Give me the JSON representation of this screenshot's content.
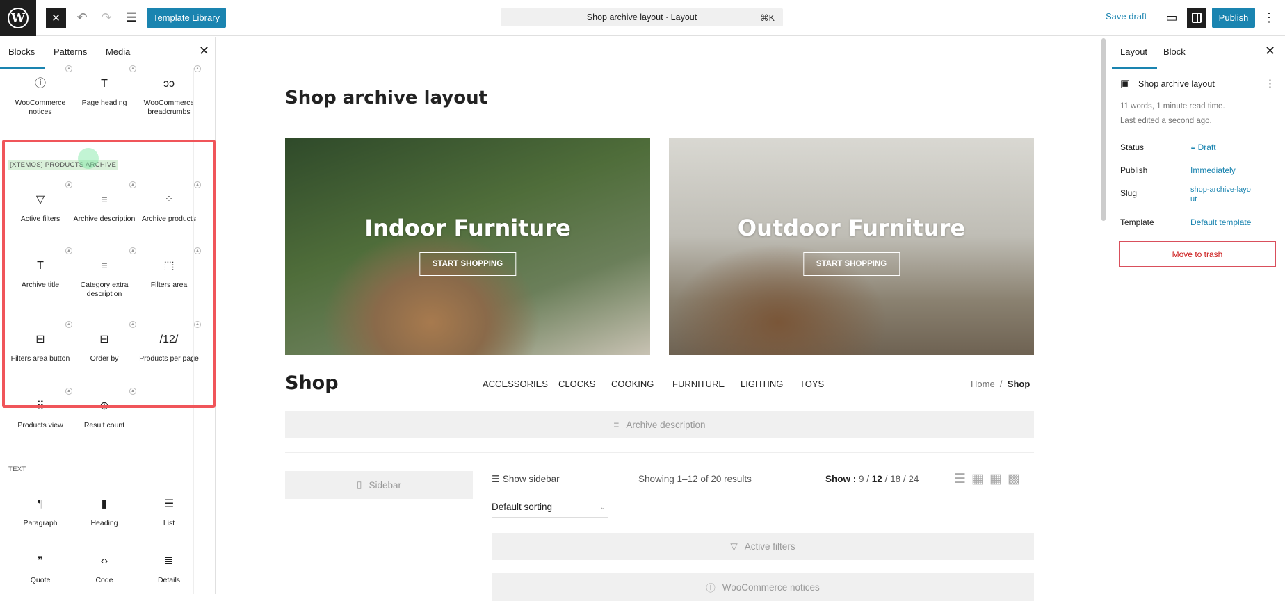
{
  "topbar": {
    "template_library": "Template Library",
    "command": "Shop archive layout · Layout",
    "shortcut": "⌘K",
    "save_draft": "Save draft",
    "publish": "Publish"
  },
  "inserter": {
    "tabs": [
      "Blocks",
      "Patterns",
      "Media"
    ],
    "top_blocks": [
      {
        "label": "WooCommerce notices",
        "icon": "info-icon"
      },
      {
        "label": "Page heading",
        "icon": "heading-icon"
      },
      {
        "label": "WooCommerce breadcrumbs",
        "icon": "breadcrumbs-icon"
      }
    ],
    "category": "[XTEMOS] PRODUCTS ARCHIVE",
    "archive_blocks": [
      {
        "label": "Active filters",
        "icon": "filter-icon"
      },
      {
        "label": "Archive description",
        "icon": "description-icon"
      },
      {
        "label": "Archive products",
        "icon": "grid-icon"
      },
      {
        "label": "Archive title",
        "icon": "title-icon"
      },
      {
        "label": "Category extra description",
        "icon": "description-icon"
      },
      {
        "label": "Filters area",
        "icon": "filters-area-icon"
      },
      {
        "label": "Filters area button",
        "icon": "button-icon"
      },
      {
        "label": "Order by",
        "icon": "button-icon"
      },
      {
        "label": "Products per page",
        "icon": "per-page-icon"
      },
      {
        "label": "Products view",
        "icon": "dots-grid-icon"
      },
      {
        "label": "Result count",
        "icon": "zoom-icon"
      }
    ],
    "text_category": "TEXT",
    "text_blocks": [
      {
        "label": "Paragraph",
        "icon": "paragraph-icon"
      },
      {
        "label": "Heading",
        "icon": "bookmark-icon"
      },
      {
        "label": "List",
        "icon": "list-icon"
      },
      {
        "label": "Quote",
        "icon": "quote-icon"
      },
      {
        "label": "Code",
        "icon": "code-icon"
      },
      {
        "label": "Details",
        "icon": "details-icon"
      }
    ]
  },
  "canvas": {
    "title": "Shop archive layout",
    "heroes": [
      {
        "title": "Indoor Furniture",
        "button": "START SHOPPING"
      },
      {
        "title": "Outdoor Furniture",
        "button": "START SHOPPING"
      }
    ],
    "shop_title": "Shop",
    "categories": [
      "ACCESSORIES",
      "CLOCKS",
      "COOKING",
      "FURNITURE",
      "LIGHTING",
      "TOYS"
    ],
    "breadcrumb": {
      "home": "Home",
      "sep": "/",
      "current": "Shop"
    },
    "archive_description": "Archive description",
    "sidebar": "Sidebar",
    "show_sidebar": "Show sidebar",
    "result_count": "Showing 1–12 of 20 results",
    "show_label": "Show :",
    "per_page": [
      "9",
      "12",
      "18",
      "24"
    ],
    "per_page_selected": "12",
    "sorting": "Default sorting",
    "active_filters": "Active filters",
    "notices": "WooCommerce notices"
  },
  "settings": {
    "tabs": [
      "Layout",
      "Block"
    ],
    "title": "Shop archive layout",
    "words": "11 words, 1 minute read time.",
    "edited": "Last edited a second ago.",
    "rows": [
      {
        "label": "Status",
        "value": "Draft"
      },
      {
        "label": "Publish",
        "value": "Immediately"
      },
      {
        "label": "Slug",
        "value": "shop-archive-layout"
      },
      {
        "label": "Template",
        "value": "Default template"
      }
    ],
    "trash": "Move to trash"
  },
  "colors": {
    "accent": "#1a84b0",
    "highlight": "#f0555a"
  }
}
